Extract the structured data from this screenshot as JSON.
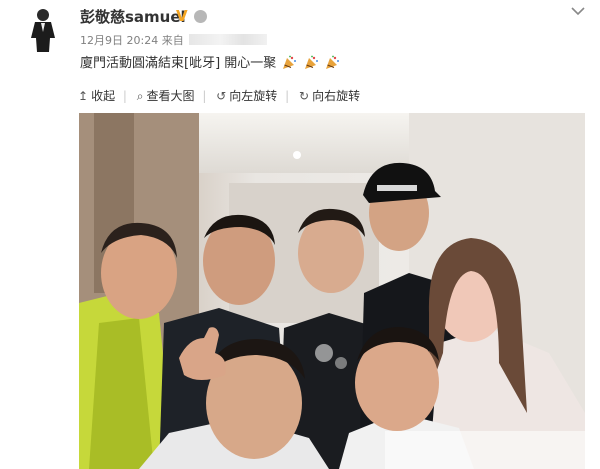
{
  "post": {
    "username": "彭敬慈samuel",
    "verified_badge": "V",
    "timestamp": "12月9日 20:24",
    "source_prefix": "来自",
    "text": "廈門活動圓滿結束[呲牙] 開心一聚",
    "emoji_icon": "party-popper-icon"
  },
  "toolbar": {
    "collapse": "收起",
    "view_large": "查看大图",
    "rotate_left": "向左旋转",
    "rotate_right": "向右旋转",
    "collapse_icon": "↥",
    "view_large_icon": "⌕",
    "rotate_left_icon": "↺",
    "rotate_right_icon": "↻"
  },
  "colors": {
    "verified": "#f5a623",
    "text_primary": "#333333",
    "text_meta": "#808080"
  }
}
